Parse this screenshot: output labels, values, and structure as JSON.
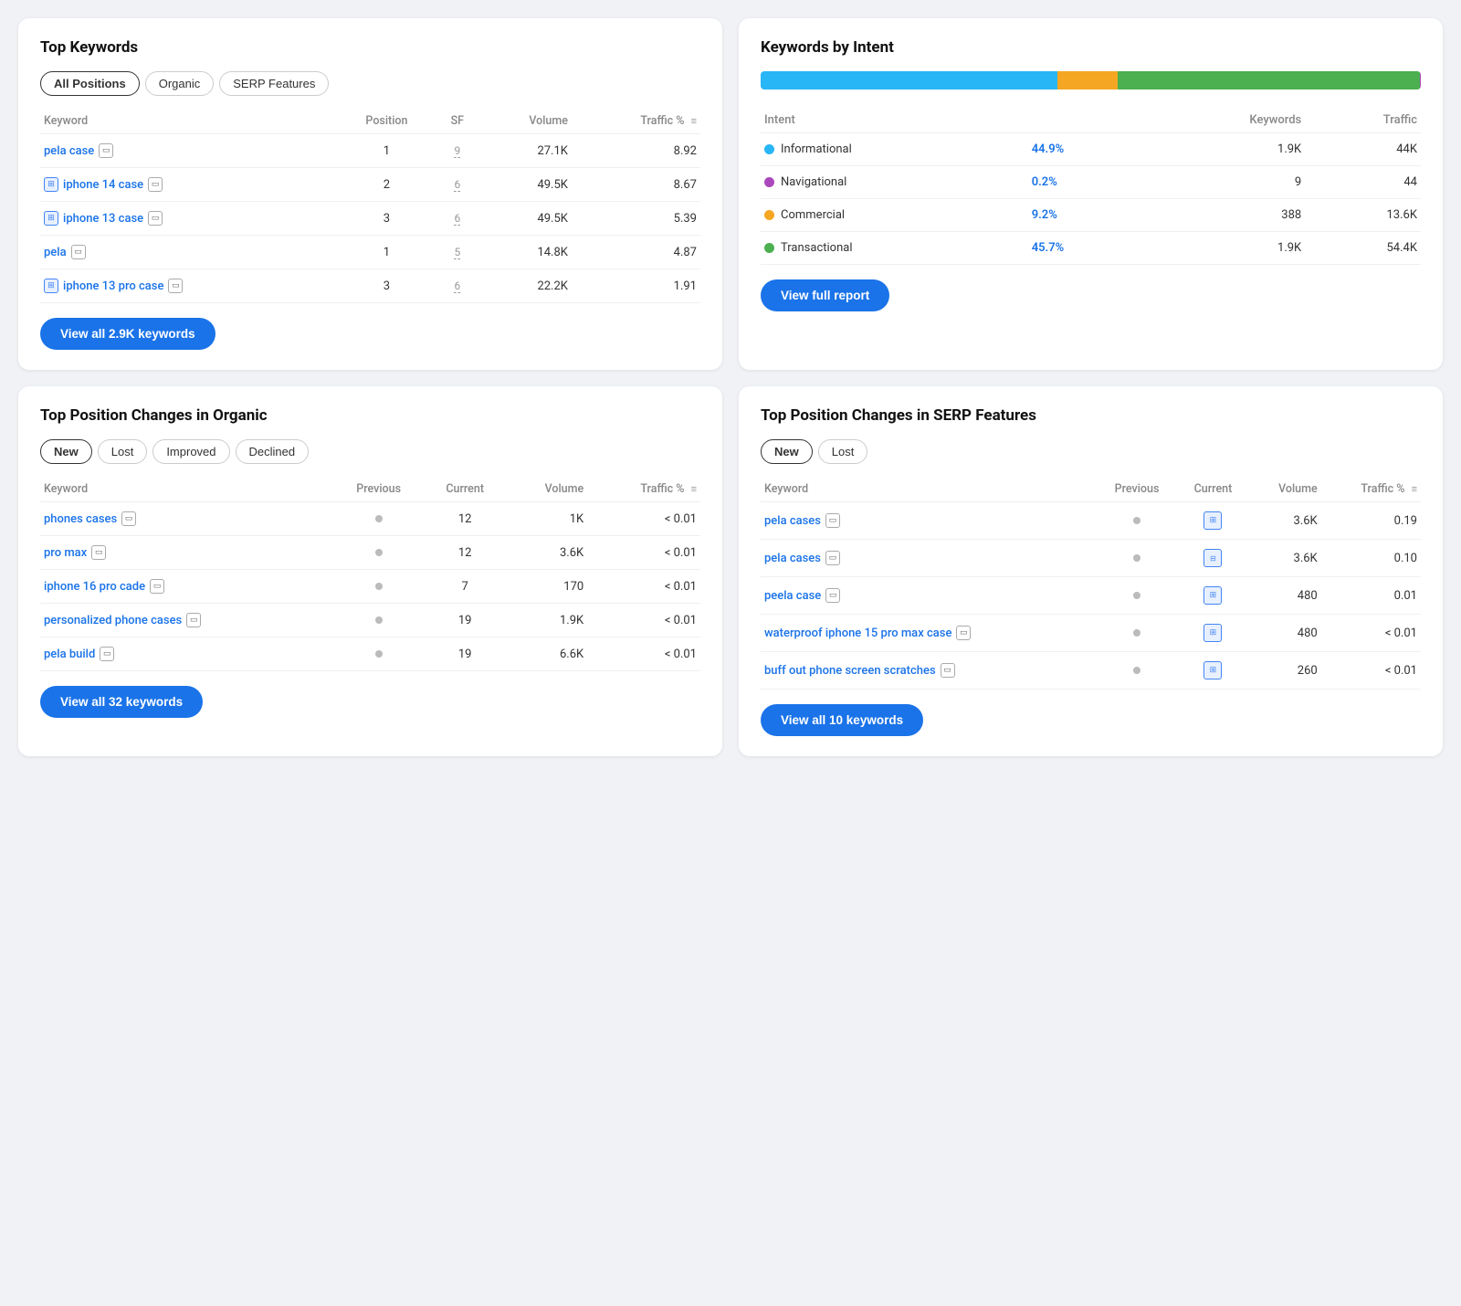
{
  "topKeywords": {
    "title": "Top Keywords",
    "tabs": [
      {
        "label": "All Positions",
        "active": true
      },
      {
        "label": "Organic",
        "active": false
      },
      {
        "label": "SERP Features",
        "active": false
      }
    ],
    "columns": [
      "Keyword",
      "Position",
      "SF",
      "Volume",
      "Traffic %"
    ],
    "rows": [
      {
        "keyword": "pela case",
        "hasIcon": false,
        "iconType": "none",
        "position": "1",
        "sf": "9",
        "volume": "27.1K",
        "traffic": "8.92"
      },
      {
        "keyword": "iphone 14 case",
        "hasIcon": true,
        "iconType": "img",
        "position": "2",
        "sf": "6",
        "volume": "49.5K",
        "traffic": "8.67"
      },
      {
        "keyword": "iphone 13 case",
        "hasIcon": true,
        "iconType": "img",
        "position": "3",
        "sf": "6",
        "volume": "49.5K",
        "traffic": "5.39"
      },
      {
        "keyword": "pela",
        "hasIcon": false,
        "iconType": "none",
        "position": "1",
        "sf": "5",
        "volume": "14.8K",
        "traffic": "4.87"
      },
      {
        "keyword": "iphone 13 pro case",
        "hasIcon": true,
        "iconType": "img",
        "position": "3",
        "sf": "6",
        "volume": "22.2K",
        "traffic": "1.91"
      }
    ],
    "viewAllLabel": "View all 2.9K keywords"
  },
  "keywordsByIntent": {
    "title": "Keywords by Intent",
    "barSegments": [
      {
        "color": "#29b6f6",
        "pct": 44.9
      },
      {
        "color": "#f5a623",
        "pct": 9.2
      },
      {
        "color": "#4caf50",
        "pct": 45.7
      },
      {
        "color": "#ab47bc",
        "pct": 0.2
      }
    ],
    "columns": [
      "Intent",
      "",
      "Keywords",
      "Traffic"
    ],
    "rows": [
      {
        "dot": "#29b6f6",
        "intent": "Informational",
        "pct": "44.9%",
        "keywords": "1.9K",
        "traffic": "44K"
      },
      {
        "dot": "#ab47bc",
        "intent": "Navigational",
        "pct": "0.2%",
        "keywords": "9",
        "traffic": "44"
      },
      {
        "dot": "#f5a623",
        "intent": "Commercial",
        "pct": "9.2%",
        "keywords": "388",
        "traffic": "13.6K"
      },
      {
        "dot": "#4caf50",
        "intent": "Transactional",
        "pct": "45.7%",
        "keywords": "1.9K",
        "traffic": "54.4K"
      }
    ],
    "viewReportLabel": "View full report"
  },
  "topPositionOrganic": {
    "title": "Top Position Changes in Organic",
    "tabs": [
      {
        "label": "New",
        "active": true
      },
      {
        "label": "Lost",
        "active": false
      },
      {
        "label": "Improved",
        "active": false
      },
      {
        "label": "Declined",
        "active": false
      }
    ],
    "columns": [
      "Keyword",
      "Previous",
      "Current",
      "Volume",
      "Traffic %"
    ],
    "rows": [
      {
        "keyword": "phones cases",
        "previous": "·",
        "current": "12",
        "volume": "1K",
        "traffic": "< 0.01"
      },
      {
        "keyword": "pro max",
        "previous": "·",
        "current": "12",
        "volume": "3.6K",
        "traffic": "< 0.01"
      },
      {
        "keyword": "iphone 16 pro cade",
        "previous": "·",
        "current": "7",
        "volume": "170",
        "traffic": "< 0.01"
      },
      {
        "keyword": "personalized phone cases",
        "previous": "·",
        "current": "19",
        "volume": "1.9K",
        "traffic": "< 0.01"
      },
      {
        "keyword": "pela build",
        "previous": "·",
        "current": "19",
        "volume": "6.6K",
        "traffic": "< 0.01"
      }
    ],
    "viewAllLabel": "View all 32 keywords"
  },
  "topPositionSERP": {
    "title": "Top Position Changes in SERP Features",
    "tabs": [
      {
        "label": "New",
        "active": true
      },
      {
        "label": "Lost",
        "active": false
      }
    ],
    "columns": [
      "Keyword",
      "Previous",
      "Current",
      "Volume",
      "Traffic %"
    ],
    "rows": [
      {
        "keyword": "pela cases",
        "previous": "·",
        "currentIcon": "sq",
        "volume": "3.6K",
        "traffic": "0.19"
      },
      {
        "keyword": "pela cases",
        "previous": "·",
        "currentIcon": "sq2",
        "volume": "3.6K",
        "traffic": "0.10"
      },
      {
        "keyword": "peela case",
        "previous": "·",
        "currentIcon": "sq",
        "volume": "480",
        "traffic": "0.01"
      },
      {
        "keyword": "waterproof iphone 15 pro max case",
        "previous": "·",
        "currentIcon": "sq",
        "volume": "480",
        "traffic": "< 0.01"
      },
      {
        "keyword": "buff out phone screen scratches",
        "previous": "·",
        "currentIcon": "sq",
        "volume": "260",
        "traffic": "< 0.01"
      }
    ],
    "viewAllLabel": "View all 10 keywords"
  },
  "icons": {
    "minus-square": "▭",
    "image-icon": "⊞",
    "filter-icon": "≡"
  }
}
